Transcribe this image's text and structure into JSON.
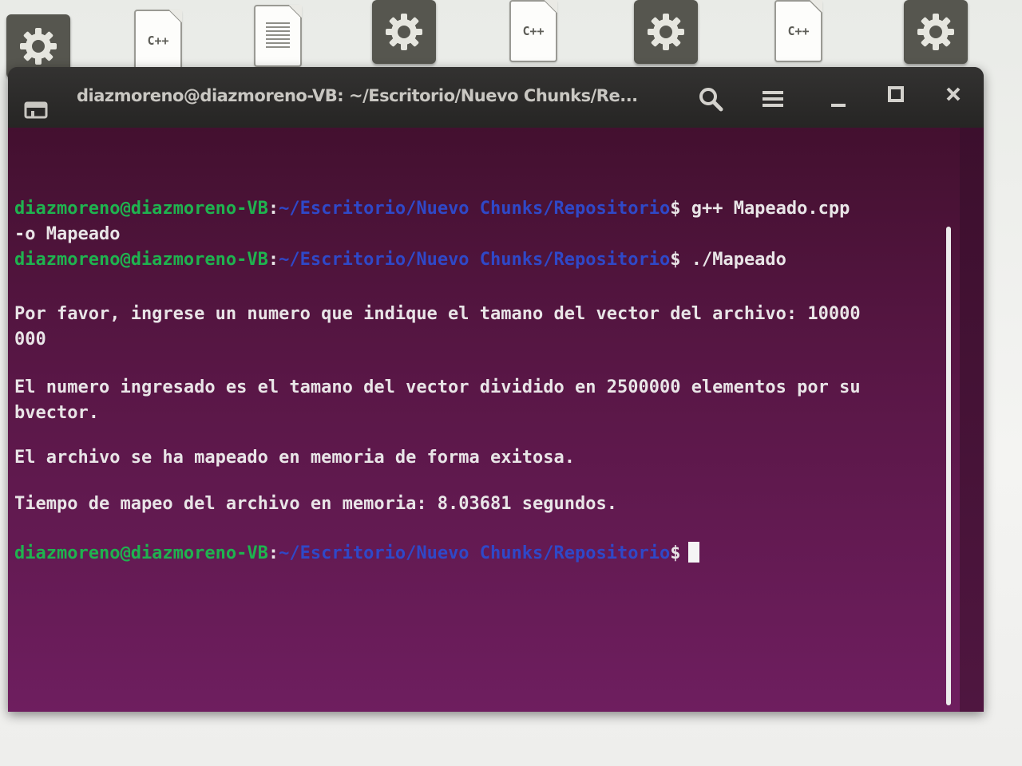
{
  "desktop": {
    "icons": [
      {
        "type": "gear",
        "icon": "gear-icon"
      },
      {
        "type": "cpp",
        "label": "C++"
      },
      {
        "type": "text",
        "icon": "text-file-icon"
      },
      {
        "type": "gear",
        "icon": "gear-icon"
      },
      {
        "type": "cpp",
        "label": "C++"
      },
      {
        "type": "gear",
        "icon": "gear-icon"
      },
      {
        "type": "cpp",
        "label": "C++"
      },
      {
        "type": "gear",
        "icon": "gear-icon"
      }
    ]
  },
  "terminal": {
    "title": "diazmoreno@diazmoreno-VB: ~/Escritorio/Nuevo Chunks/Re...",
    "prompt": {
      "user_host": "diazmoreno@diazmoreno-VB",
      "colon": ":",
      "path": "~/Escritorio/Nuevo Chunks/Repositorio",
      "dollar": "$"
    },
    "commands": {
      "compile": " g++ Mapeado.cpp",
      "compile_wrap": "-o Mapeado",
      "run": " ./Mapeado"
    },
    "output": {
      "ask_line1": "Por favor, ingrese un numero que indique el tamano del vector del archivo: 10000",
      "ask_line2": "000",
      "info_line1": "El numero ingresado es el tamano del vector dividido en 2500000 elementos por su",
      "info_line2": "bvector.",
      "success": "El archivo se ha mapeado en memoria de forma exitosa.",
      "time": "Tiempo de mapeo del archivo en memoria: 8.03681 segundos."
    }
  },
  "colors": {
    "terminal_bg": "#5a1747",
    "prompt_user": "#1fb34f",
    "prompt_path": "#2f48c8",
    "text": "#e9e5e7"
  }
}
